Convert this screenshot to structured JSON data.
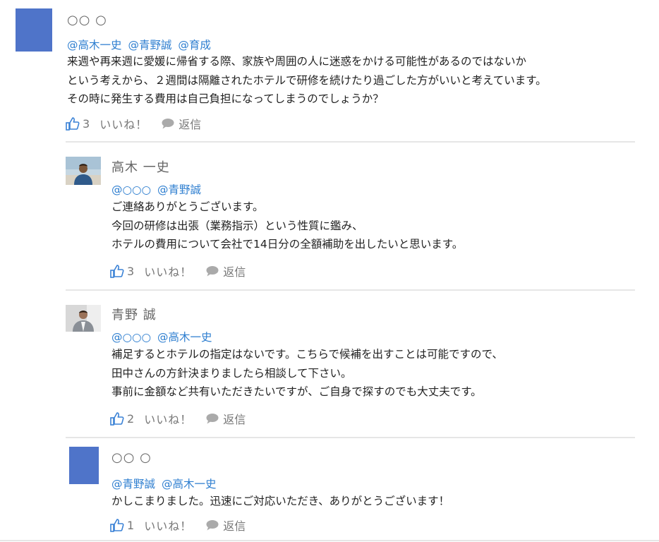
{
  "posts": [
    {
      "author": "○○ ○",
      "avatar": "blue-square",
      "mentions": [
        "@高木一史",
        "@青野誠",
        "@育成"
      ],
      "lines": [
        "来週や再来週に愛媛に帰省する際、家族や周囲の人に迷惑をかける可能性があるのではないか",
        "という考えから、２週間は隔離されたホテルで研修を続けたり過ごした方がいいと考えています。",
        "その時に発生する費用は自己負担になってしまうのでしょうか？"
      ],
      "likes": "3",
      "like_label": "いいね！",
      "reply_label": "返信"
    },
    {
      "author": "高木 一史",
      "avatar": "photo",
      "mentions": [
        "@○○○",
        "@青野誠"
      ],
      "lines": [
        "ご連絡ありがとうございます。",
        "今回の研修は出張（業務指示）という性質に鑑み、",
        "ホテルの費用について会社で14日分の全額補助を出したいと思います。"
      ],
      "likes": "3",
      "like_label": "いいね！",
      "reply_label": "返信"
    },
    {
      "author": "青野 誠",
      "avatar": "photo",
      "mentions": [
        "@○○○",
        "@高木一史"
      ],
      "lines": [
        "補足するとホテルの指定はないです。こちらで候補を出すことは可能ですので、",
        "田中さんの方針決まりましたら相談して下さい。",
        "事前に金額など共有いただきたいですが、ご自身で探すのでも大丈夫です。"
      ],
      "likes": "2",
      "like_label": "いいね！",
      "reply_label": "返信"
    },
    {
      "author": "○○ ○",
      "avatar": "blue-square",
      "mentions": [
        "@青野誠",
        "@高木一史"
      ],
      "lines": [
        "かしこまりました。迅速にご対応いただき、ありがとうございます！"
      ],
      "likes": "1",
      "like_label": "いいね！",
      "reply_label": "返信"
    }
  ],
  "colors": {
    "avatar_blue": "#4f74c9",
    "mention_blue": "#2f7fd0",
    "icon_blue": "#3b82d6"
  }
}
